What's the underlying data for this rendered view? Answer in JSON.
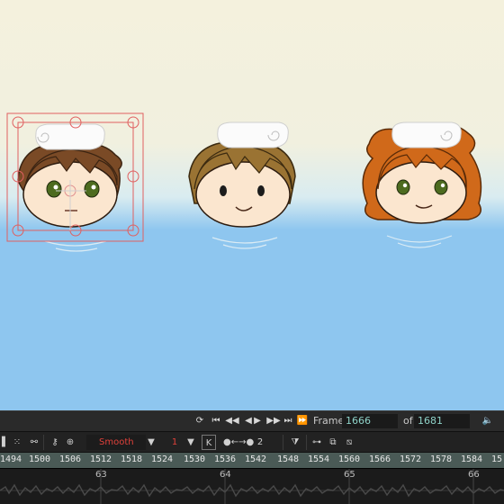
{
  "canvas": {
    "sky_top": "#f4f1dd",
    "water": "#8ec6ef",
    "selected_character": "left-boy",
    "characters": [
      "left-boy",
      "middle-boy",
      "right-girl"
    ]
  },
  "playback": {
    "frame_label": "Frame",
    "current_frame": "1666",
    "of_label": "of",
    "total_frames": "1681",
    "buttons": [
      "loop-icon",
      "first-frame-icon",
      "prev-key-icon",
      "prev-frame-icon",
      "play-icon",
      "next-frame-icon",
      "next-key-icon",
      "last-frame-icon"
    ],
    "volume_icon": "speaker-icon"
  },
  "toolbar": {
    "interpolation": "Smooth",
    "interpolation_color": "#e0413a",
    "step_value": "1",
    "onion_count": "2"
  },
  "timeline": {
    "ruler_frames": [
      "1494",
      "1500",
      "1506",
      "1512",
      "1518",
      "1524",
      "1530",
      "1536",
      "1542",
      "1548",
      "1554",
      "1560",
      "1566",
      "1572",
      "1578",
      "1584",
      "15"
    ],
    "seconds_marks": [
      "63",
      "64",
      "65",
      "66"
    ]
  }
}
